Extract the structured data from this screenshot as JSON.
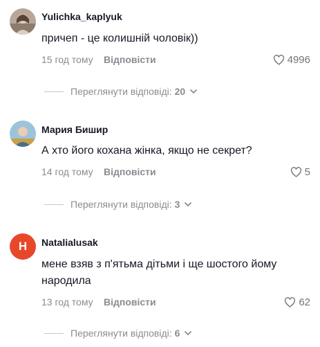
{
  "comments": [
    {
      "username": "Yulichka_kaplyuk",
      "text": "причеп - це колишній чоловік))",
      "time": "15 год тому",
      "reply_label": "Відповісти",
      "likes": "4996",
      "view_replies_label": "Переглянути відповіді:",
      "replies_count": "20",
      "avatar_icon": "photo-avatar"
    },
    {
      "username": "Мария Бишир",
      "text": "А хто його кохана жінка, якщо не секрет?",
      "time": "14 год тому",
      "reply_label": "Відповісти",
      "likes": "5",
      "view_replies_label": "Переглянути відповіді:",
      "replies_count": "3",
      "avatar_icon": "photo-avatar"
    },
    {
      "username": "Natalialusak",
      "text": "мене взяв з п'ятьма дітьми і ще шостого йому народила",
      "time": "13 год тому",
      "reply_label": "Відповісти",
      "likes": "62",
      "view_replies_label": "Переглянути відповіді:",
      "replies_count": "6",
      "avatar_letter": "H",
      "avatar_color": "#e8482a"
    }
  ],
  "colors": {
    "text": "#161823",
    "muted": "#8a8b91",
    "accent_avatar": "#e8482a"
  },
  "icons": [
    "heart-outline-icon",
    "chevron-down-icon"
  ]
}
